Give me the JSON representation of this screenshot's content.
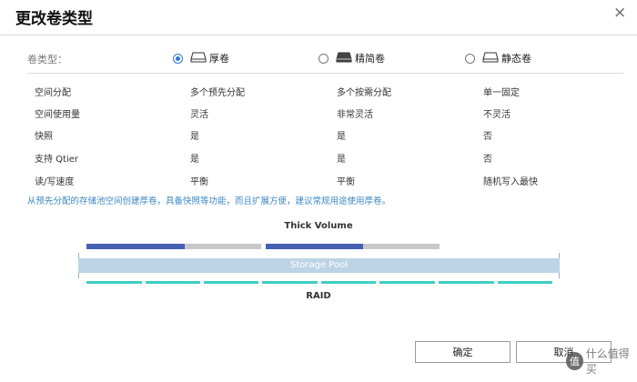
{
  "dialog": {
    "title": "更改卷类型",
    "close_label": "×"
  },
  "volume_type": {
    "label": "卷类型：",
    "options": [
      {
        "label": "厚卷",
        "icon": "drive-outline-icon",
        "selected": true
      },
      {
        "label": "精简卷",
        "icon": "drive-filled-icon",
        "selected": false
      },
      {
        "label": "静态卷",
        "icon": "drive-outline-icon",
        "selected": false
      }
    ]
  },
  "comparison": {
    "rows": [
      [
        "空间分配",
        "多个预先分配",
        "多个按需分配",
        "单一固定"
      ],
      [
        "空间使用量",
        "灵活",
        "非常灵活",
        "不灵活"
      ],
      [
        "快照",
        "是",
        "是",
        "否"
      ],
      [
        "支持 Qtier",
        "是",
        "是",
        "否"
      ],
      [
        "读/写速度",
        "平衡",
        "平衡",
        "随机写入最快"
      ]
    ]
  },
  "description": "从预先分配的存储池空间创建厚卷，具备快照等功能，而且扩展方便，建议常规用途使用厚卷。",
  "diagram": {
    "title": "Thick Volume",
    "pool_label": "Storage Pool",
    "raid_label": "RAID",
    "volumes": [
      {
        "fill": 0.56
      },
      {
        "fill": 0.56
      }
    ],
    "raid_segments": 8,
    "colors": {
      "volume_used": "#4560b3",
      "volume_free": "#c8c8c8",
      "pool": "#bcd4e6",
      "raid": "#3fcfc2"
    }
  },
  "buttons": {
    "ok": "确定",
    "cancel": "取消"
  },
  "watermark": {
    "badge": "值",
    "text": "什么值得买"
  }
}
